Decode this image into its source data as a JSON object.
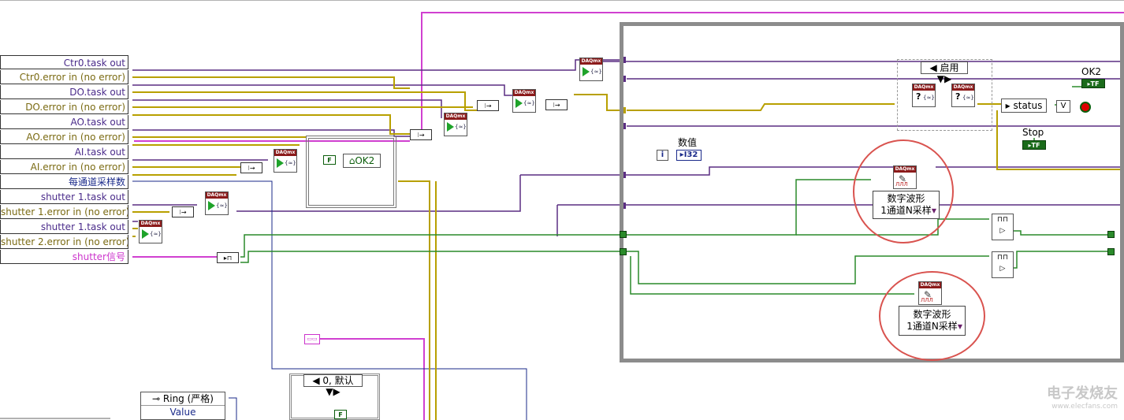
{
  "indicators": [
    {
      "label": "Ctr0.task out",
      "color": "#4a2b8a"
    },
    {
      "label": "Ctr0.error in (no error)",
      "color": "#7a6a12"
    },
    {
      "label": "DO.task out",
      "color": "#4a2b8a"
    },
    {
      "label": "DO.error in (no error)",
      "color": "#7a6a12"
    },
    {
      "label": "AO.task out",
      "color": "#4a2b8a"
    },
    {
      "label": "AO.error in (no error)",
      "color": "#7a6a12"
    },
    {
      "label": "AI.task out",
      "color": "#4a2b8a"
    },
    {
      "label": "AI.error in (no error)",
      "color": "#7a6a12"
    },
    {
      "label": "每通道采样数",
      "color": "#1a2a8a"
    },
    {
      "label": "shutter 1.task out",
      "color": "#4a2b8a"
    },
    {
      "label": "shutter 1.error in (no error)",
      "color": "#7a6a12"
    },
    {
      "label": "shutter 1.task out",
      "color": "#4a2b8a"
    },
    {
      "label": "shutter 2.error in (no error)",
      "color": "#7a6a12"
    },
    {
      "label": "shutter信号",
      "color": "#cc33cc"
    }
  ],
  "daqmx_label": "DAQmx",
  "ok2_local": "OK2",
  "false_const": "F",
  "numeric_label": "数值",
  "i32_label": "I32",
  "iter_label": "i",
  "enable_selector": "启用",
  "status_label": "status",
  "ok2_control_label": "OK2",
  "tf_label": "TF",
  "stop_label": "Stop",
  "digital_waveform_1": {
    "line1": "数字波形",
    "line2": "1通道N采样"
  },
  "digital_waveform_2": {
    "line1": "数字波形",
    "line2": "1通道N采样"
  },
  "case_selector_default": "0, 默认",
  "ring_label": "Ring (严格)",
  "ring_value": "Value",
  "watermark": {
    "main": "电子发烧友",
    "sub": "www.elecfans.com"
  },
  "colors": {
    "error_wire": "#b8a000",
    "task_wire": "#5a2d82",
    "digital_wire": "#2a8a2a",
    "pink_wire": "#d040d0",
    "frame": "#8c8c8c",
    "highlight": "#d9534f"
  }
}
